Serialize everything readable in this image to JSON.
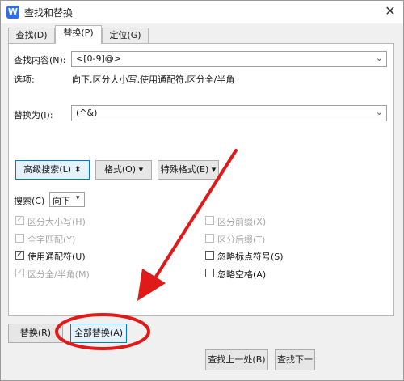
{
  "window": {
    "title": "查找和替换",
    "close_glyph": "✕"
  },
  "tabs": [
    {
      "label": "查找(D)"
    },
    {
      "label": "替换(P)"
    },
    {
      "label": "定位(G)"
    }
  ],
  "find": {
    "label": "查找内容(N):",
    "value": "<[0-9]@>"
  },
  "options": {
    "label": "选项:",
    "value": "向下,区分大小写,使用通配符,区分全/半角"
  },
  "replace": {
    "label": "替换为(I):",
    "value": "(^&)"
  },
  "buttons": {
    "advanced": "高级搜索(L) ⬍",
    "format": "格式(O)",
    "special": "特殊格式(E)",
    "replace": "替换(R)",
    "replace_all": "全部替换(A)",
    "find_prev": "查找上一处(B)",
    "find_next": "查找下一"
  },
  "search": {
    "label": "搜索(C)",
    "value": "向下"
  },
  "checkboxes": {
    "match_case": {
      "label": "区分大小写(H)",
      "checked": true
    },
    "whole_word": {
      "label": "全字匹配(Y)",
      "checked": false
    },
    "wildcards": {
      "label": "使用通配符(U)",
      "checked": true
    },
    "full_half": {
      "label": "区分全/半角(M)",
      "checked": true
    },
    "prefix": {
      "label": "区分前缀(X)",
      "checked": false
    },
    "suffix": {
      "label": "区分后缀(T)",
      "checked": false
    },
    "ignore_punct": {
      "label": "忽略标点符号(S)",
      "checked": false
    },
    "ignore_space": {
      "label": "忽略空格(A)",
      "checked": false
    }
  },
  "glyphs": {
    "dropdown": "⌄",
    "caret": "▾",
    "check": "✓"
  },
  "colors": {
    "annotation_red": "#e01919",
    "accent": "#0078d7"
  }
}
